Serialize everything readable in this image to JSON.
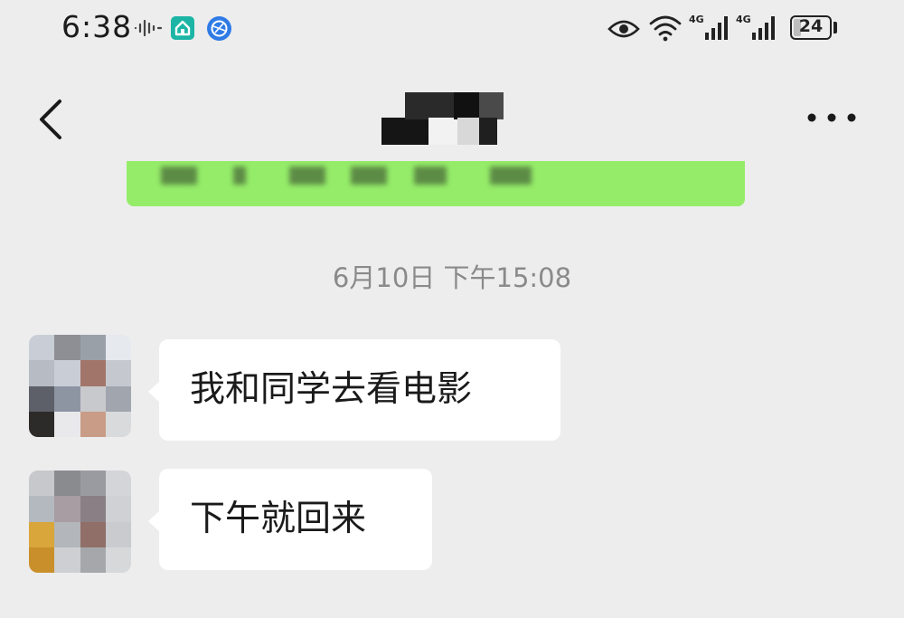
{
  "status_bar": {
    "time": "6:38",
    "battery_level": "24",
    "network_labels": [
      "4G",
      "4G"
    ],
    "icons": [
      "audio-wave-icon",
      "home-app-icon",
      "globe-app-icon",
      "eye-icon",
      "wifi-icon",
      "signal-4g-icon",
      "signal-4g-icon",
      "battery-icon"
    ]
  },
  "nav_bar": {
    "back_icon": "chevron-left-icon",
    "title": "",
    "more_icon": "more-dots-icon"
  },
  "chat": {
    "timestamp": "6月10日 下午15:08",
    "messages": [
      {
        "side": "left",
        "text": "我和同学去看电影"
      },
      {
        "side": "left",
        "text": "下午就回来"
      }
    ]
  },
  "colors": {
    "background": "#ededed",
    "sent_bubble": "#95ec69",
    "received_bubble": "#ffffff",
    "timestamp_text": "#8a8a8a"
  }
}
